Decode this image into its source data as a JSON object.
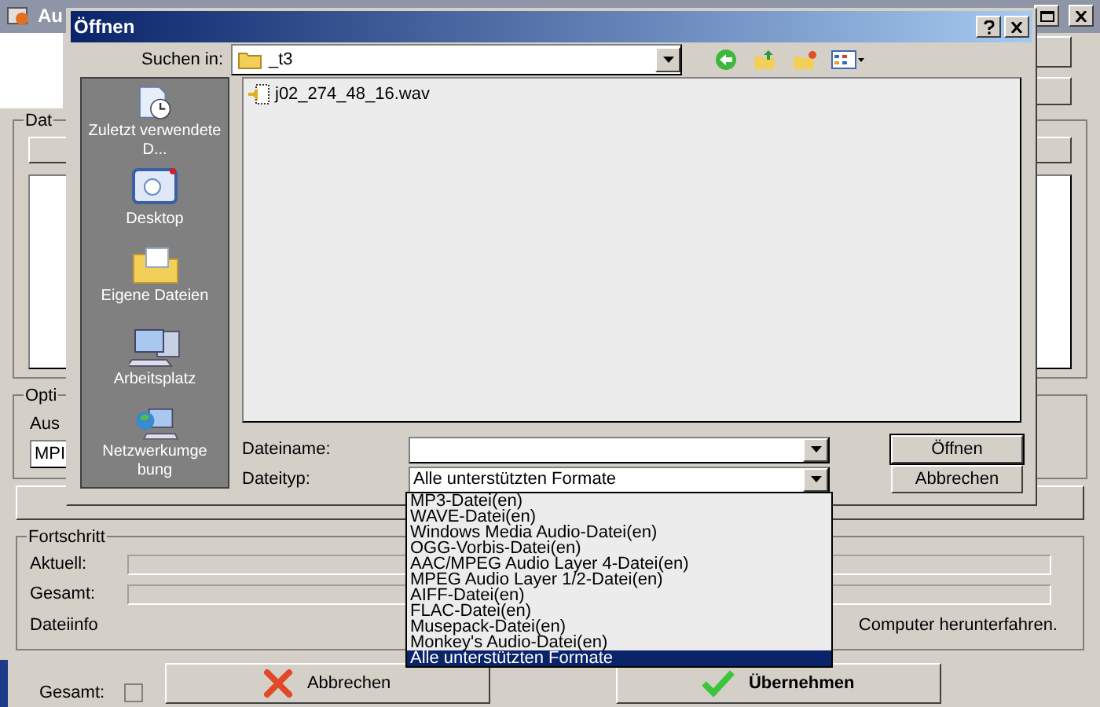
{
  "main_window": {
    "title": "Au",
    "data_group": "Dat",
    "options_group": "Opti",
    "output_label": "Aus",
    "output_field": "MPI",
    "progress": {
      "title": "Fortschritt",
      "rows": [
        {
          "label": "Aktuell:",
          "level": 0
        },
        {
          "label": "Gesamt:",
          "level": 0
        }
      ],
      "info_label": "Dateiinfo",
      "shutdown_text": "Computer herunterfahren."
    },
    "footer": {
      "total_label": "Gesamt:",
      "buttons": [
        {
          "label": "Abbrechen",
          "kind": "cancel"
        },
        {
          "label": "Übernehmen",
          "kind": "apply"
        }
      ]
    }
  },
  "dialog": {
    "title": "Öffnen",
    "look_in_label": "Suchen in:",
    "look_in_value": "_t3",
    "places": [
      {
        "label": "Zuletzt verwendete D...",
        "kind": "recent"
      },
      {
        "label": "Desktop",
        "kind": "desktop"
      },
      {
        "label": "Eigene Dateien",
        "kind": "documents"
      },
      {
        "label": "Arbeitsplatz",
        "kind": "computer"
      },
      {
        "label": "Netzwerkumgebung",
        "kind": "network"
      }
    ],
    "files": [
      {
        "name": "j02_274_48_16.wav"
      }
    ],
    "filename_label": "Dateiname:",
    "filetype_label": "Dateityp:",
    "filetype_value": "Alle unterstützten Formate",
    "filetype_options": [
      {
        "label": "MP3-Datei(en)",
        "selected": false
      },
      {
        "label": "WAVE-Datei(en)",
        "selected": false
      },
      {
        "label": "Windows Media Audio-Datei(en)",
        "selected": false
      },
      {
        "label": "OGG-Vorbis-Datei(en)",
        "selected": false
      },
      {
        "label": "AAC/MPEG Audio Layer 4-Datei(en)",
        "selected": false
      },
      {
        "label": "MPEG Audio Layer 1/2-Datei(en)",
        "selected": false
      },
      {
        "label": "AIFF-Datei(en)",
        "selected": false
      },
      {
        "label": "FLAC-Datei(en)",
        "selected": false
      },
      {
        "label": "Musepack-Datei(en)",
        "selected": false
      },
      {
        "label": "Monkey's Audio-Datei(en)",
        "selected": false
      },
      {
        "label": "Alle unterstützten Formate",
        "selected": true
      }
    ],
    "buttons": [
      {
        "label": "Öffnen",
        "kind": "default"
      },
      {
        "label": "Abbrechen",
        "kind": "normal"
      }
    ]
  }
}
